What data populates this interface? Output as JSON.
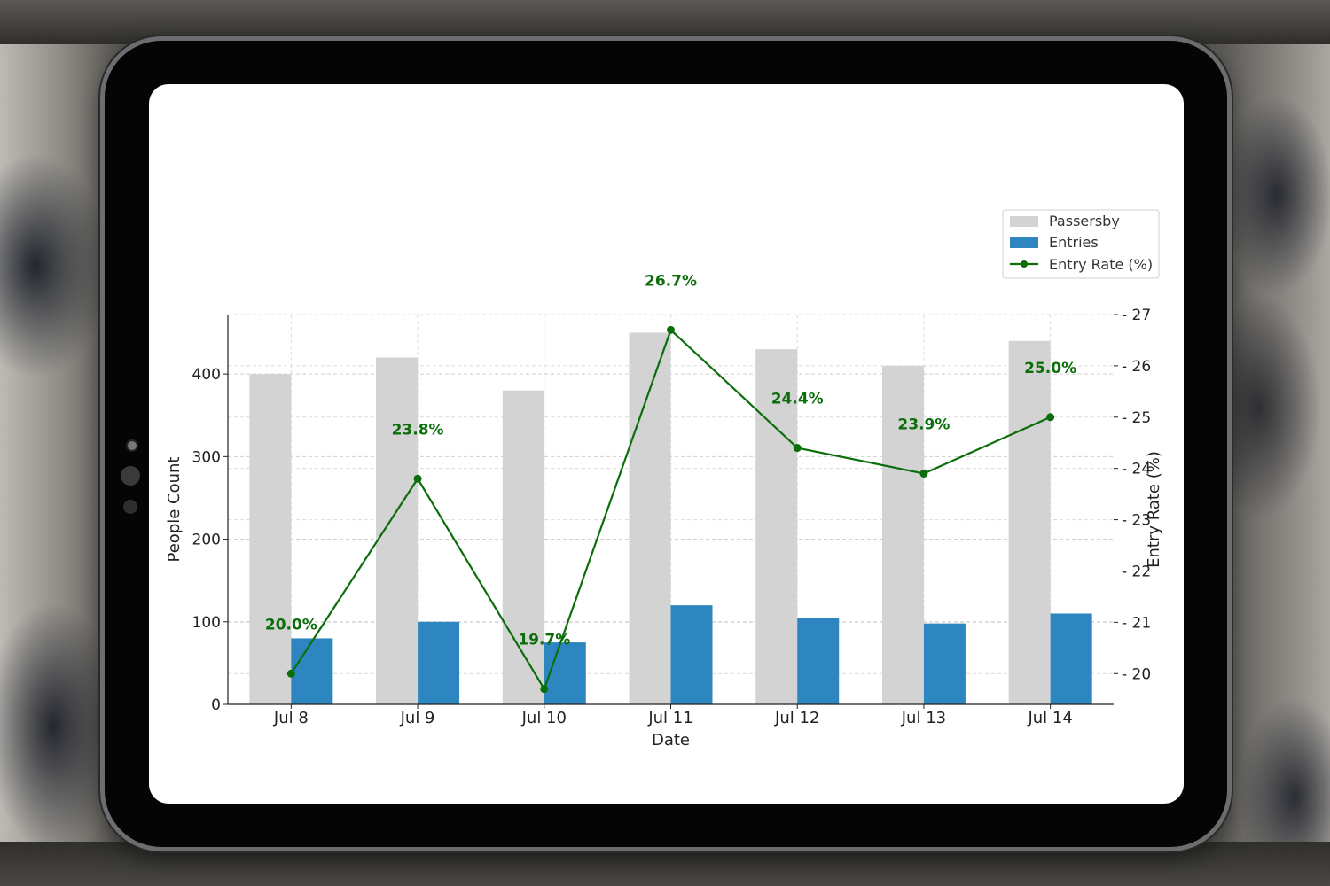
{
  "chart_data": {
    "type": "bar",
    "categories": [
      "Jul 8",
      "Jul 9",
      "Jul 10",
      "Jul 11",
      "Jul 12",
      "Jul 13",
      "Jul 14"
    ],
    "series": [
      {
        "name": "Passersby",
        "type": "bar",
        "axis": "left",
        "color": "#d3d3d3",
        "values": [
          400,
          420,
          380,
          450,
          430,
          410,
          440
        ]
      },
      {
        "name": "Entries",
        "type": "bar",
        "axis": "left",
        "color": "#2e86c1",
        "values": [
          80,
          100,
          75,
          120,
          105,
          98,
          110
        ]
      },
      {
        "name": "Entry Rate (%)",
        "type": "line",
        "axis": "right",
        "color": "#0b6e0b",
        "values": [
          20.0,
          23.8,
          19.7,
          26.7,
          24.4,
          23.9,
          25.0
        ]
      }
    ],
    "data_labels": [
      "20.0%",
      "23.8%",
      "19.7%",
      "26.7%",
      "24.4%",
      "23.9%",
      "25.0%"
    ],
    "xlabel": "Date",
    "ylabel": "People Count",
    "y2label": "Entry Rate (%)",
    "ylim": [
      0,
      472
    ],
    "y2lim": [
      19.4,
      27
    ],
    "yticks": [
      0,
      100,
      200,
      300,
      400
    ],
    "y2ticks": [
      20,
      21,
      22,
      23,
      24,
      25,
      26,
      27
    ],
    "grid": true,
    "legend_position": "top-right"
  }
}
